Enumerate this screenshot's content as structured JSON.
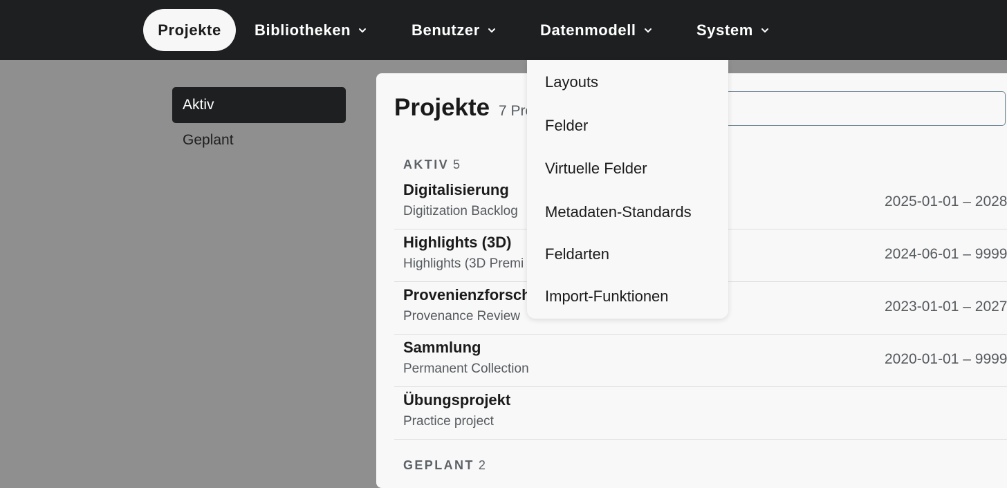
{
  "nav": {
    "items": [
      {
        "label": "Projekte",
        "active": true
      },
      {
        "label": "Bibliotheken",
        "icon": "chevron-down-icon"
      },
      {
        "label": "Benutzer",
        "icon": "chevron-down-icon"
      },
      {
        "label": "Datenmodell",
        "icon": "chevron-down-icon"
      },
      {
        "label": "System",
        "icon": "chevron-down-icon"
      }
    ]
  },
  "sidebar": {
    "items": [
      {
        "label": "Aktiv",
        "active": true
      },
      {
        "label": "Geplant"
      }
    ]
  },
  "main": {
    "title": "Projekte",
    "count_text": "7 Pro",
    "groups": [
      {
        "label": "AKTIV",
        "count": "5",
        "rows": [
          {
            "name": "Digitalisierung",
            "subtitle": "Digitization Backlog",
            "dates": "2025-01-01 – 2028"
          },
          {
            "name": "Highlights (3D)",
            "subtitle": "Highlights (3D Premi",
            "dates": "2024-06-01 – 9999"
          },
          {
            "name": "Provenienzforsch",
            "subtitle": "Provenance Review",
            "dates": "2023-01-01 – 2027"
          },
          {
            "name": "Sammlung",
            "subtitle": "Permanent Collection",
            "dates": "2020-01-01 – 9999"
          },
          {
            "name": "Übungsprojekt",
            "subtitle": "Practice project",
            "dates": ""
          }
        ]
      },
      {
        "label": "GEPLANT",
        "count": "2",
        "rows": []
      }
    ]
  },
  "dropdown": {
    "items": [
      "Layouts",
      "Felder",
      "Virtuelle Felder",
      "Metadaten-Standards",
      "Feldarten",
      "Import-Funktionen"
    ]
  },
  "colors": {
    "topbar": "#1e1f20",
    "overlay": "#8f8f8f",
    "panel": "#f8f8f8",
    "muted_text": "#555a5e"
  }
}
